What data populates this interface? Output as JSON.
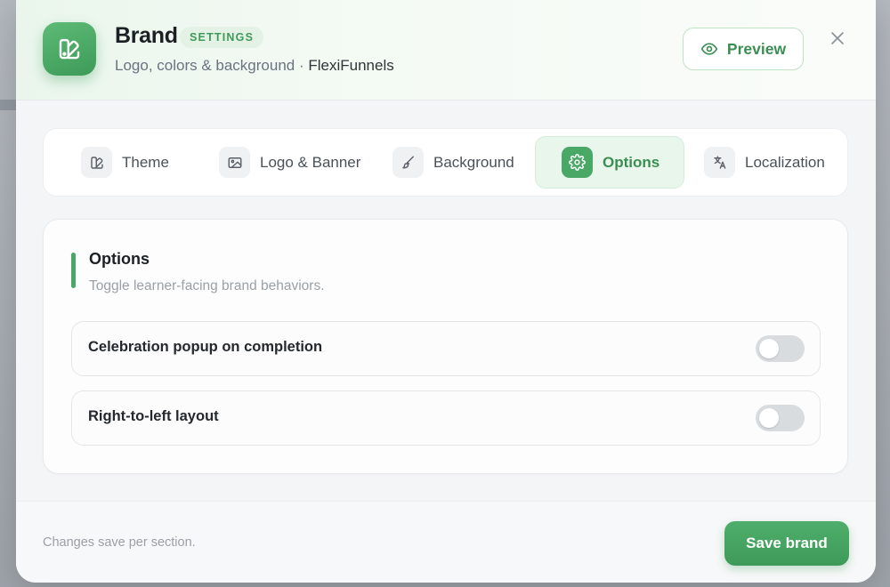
{
  "header": {
    "title": "Brand",
    "badge": "SETTINGS",
    "subtitle": "Logo, colors & background · ",
    "org": "FlexiFunnels",
    "preview_label": "Preview",
    "app_icon": "brand-palette-icon"
  },
  "tabs": [
    {
      "label": "Theme",
      "icon": "palette-icon",
      "active": false
    },
    {
      "label": "Logo & Banner",
      "icon": "image-icon",
      "active": false
    },
    {
      "label": "Background",
      "icon": "brush-icon",
      "active": false
    },
    {
      "label": "Options",
      "icon": "gear-icon",
      "active": true
    },
    {
      "label": "Localization",
      "icon": "translate-icon",
      "active": false
    }
  ],
  "section": {
    "title": "Options",
    "description": "Toggle learner-facing brand behaviors."
  },
  "options": [
    {
      "label": "Celebration popup on completion",
      "enabled": false
    },
    {
      "label": "Right-to-left layout",
      "enabled": false
    }
  ],
  "footer": {
    "note": "Changes save per section.",
    "save_label": "Save brand"
  },
  "colors": {
    "accent": "#4aa866",
    "accent_dark": "#3b8e52",
    "toggle_off": "#d9dcdf"
  }
}
